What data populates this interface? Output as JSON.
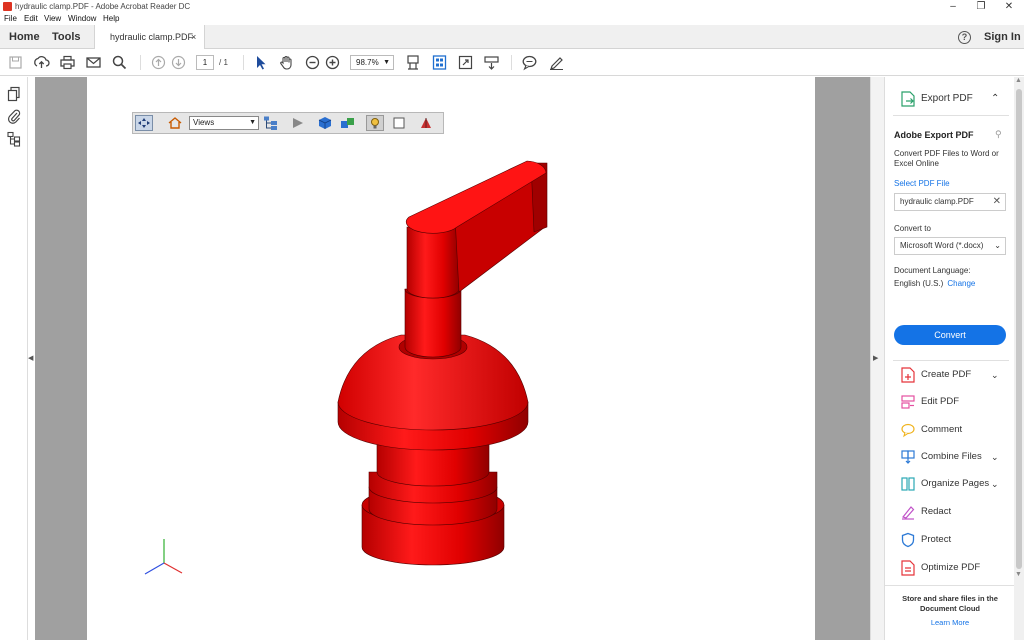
{
  "window": {
    "title": "hydraulic clamp.PDF - Adobe Acrobat Reader DC",
    "minimize": "–",
    "restore": "❐",
    "close": "✕"
  },
  "menu": [
    "File",
    "Edit",
    "View",
    "Window",
    "Help"
  ],
  "tabs": {
    "home": "Home",
    "tools": "Tools",
    "document": "hydraulic clamp.PDF",
    "document_close": "×",
    "help_icon": "?",
    "sign_in": "Sign In"
  },
  "toolbar": {
    "icons": [
      "save-icon",
      "upload-icon",
      "print-icon",
      "email-icon",
      "search-icon",
      "prev-page-icon",
      "next-page-icon",
      "select-arrow-icon",
      "hand-icon",
      "zoom-out-icon",
      "zoom-in-icon",
      "fit-page-icon",
      "page-scroll-icon",
      "fullscreen-icon",
      "read-mode-icon",
      "comment-icon",
      "sign-icon"
    ],
    "page_current": "1",
    "page_total": "/ 1",
    "zoom": "98.7%"
  },
  "toolbar3d": {
    "views_value": "Views",
    "icons": [
      "rotate-icon",
      "home-view-icon",
      "model-tree-icon",
      "play-icon",
      "projection-icon",
      "render-mode-icon",
      "lighting-icon",
      "background-color-icon",
      "cross-section-icon"
    ]
  },
  "model": {
    "part": "hydraulic clamp",
    "color": "#e00000",
    "axis_colors": {
      "x": "#e03030",
      "y": "#30b030",
      "z": "#3050e0"
    }
  },
  "right_panel": {
    "export_header": "Export PDF",
    "adobe_export_title": "Adobe Export PDF",
    "description": "Convert PDF Files to Word or Excel Online",
    "select_file_link": "Select PDF File",
    "file_name": "hydraulic clamp.PDF",
    "convert_to_label": "Convert to",
    "convert_to_value": "Microsoft Word (*.docx)",
    "language_label": "Document Language:",
    "language_value": "English (U.S.)",
    "change_link": "Change",
    "convert_button": "Convert",
    "tools": [
      {
        "label": "Create PDF",
        "icon": "create-pdf-icon",
        "color": "#e5343a",
        "has_chevron": true
      },
      {
        "label": "Edit PDF",
        "icon": "edit-pdf-icon",
        "color": "#e44fa0",
        "has_chevron": false
      },
      {
        "label": "Comment",
        "icon": "comment-icon",
        "color": "#f0b420",
        "has_chevron": false
      },
      {
        "label": "Combine Files",
        "icon": "combine-files-icon",
        "color": "#2d7ad6",
        "has_chevron": true
      },
      {
        "label": "Organize Pages",
        "icon": "organize-pages-icon",
        "color": "#2aa8b4",
        "has_chevron": true
      },
      {
        "label": "Redact",
        "icon": "redact-icon",
        "color": "#c052c8",
        "has_chevron": false
      },
      {
        "label": "Protect",
        "icon": "protect-icon",
        "color": "#2d7ad6",
        "has_chevron": false
      },
      {
        "label": "Optimize PDF",
        "icon": "optimize-pdf-icon",
        "color": "#e5343a",
        "has_chevron": false
      }
    ],
    "store_text": "Store and share files in the Document Cloud",
    "learn_more": "Learn More"
  }
}
